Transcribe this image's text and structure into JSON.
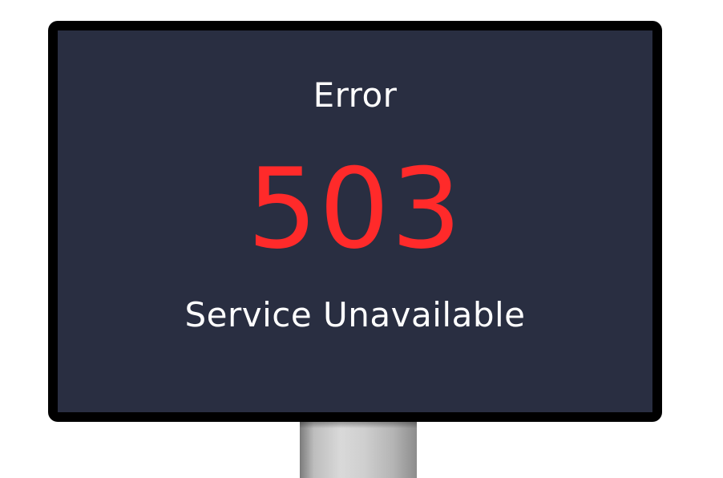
{
  "screen": {
    "heading": "Error",
    "code": "503",
    "message": "Service Unavailable"
  },
  "colors": {
    "screen_background": "#292e41",
    "bezel": "#000000",
    "code_text": "#ff2a2a",
    "text": "#ffffff",
    "stand": "#c8c8c8"
  }
}
